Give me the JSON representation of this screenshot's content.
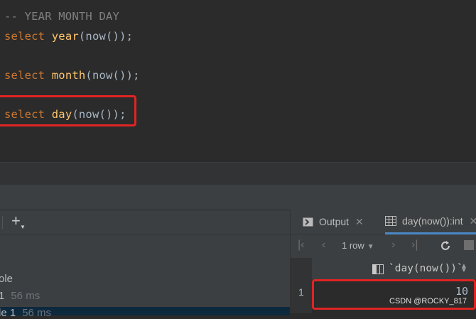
{
  "editor": {
    "comment": "-- YEAR MONTH DAY",
    "lines": [
      {
        "kw": "select",
        "fn": "year",
        "args": "(now());"
      },
      {
        "kw": "select",
        "fn": "month",
        "args": "(now());"
      },
      {
        "kw": "select",
        "fn": "day",
        "args": "(now());"
      }
    ]
  },
  "services": {
    "tree": [
      {
        "label": "ole",
        "meta": ""
      },
      {
        "label": "1",
        "meta": "56 ms"
      },
      {
        "label": "le 1",
        "meta": "56 ms"
      }
    ]
  },
  "results": {
    "tabs": [
      {
        "label": "Output",
        "icon": "output-icon"
      },
      {
        "label": "day(now()):int",
        "icon": "table-icon"
      }
    ],
    "rows_label": "1 row",
    "column": "`day(now())`",
    "row_number": "1",
    "value": "10"
  },
  "watermark": "CSDN @ROCKY_817",
  "colors": {
    "keyword": "#cc7832",
    "function": "#ffc66d",
    "highlight": "#e02424",
    "active_tab": "#4a88c7"
  }
}
